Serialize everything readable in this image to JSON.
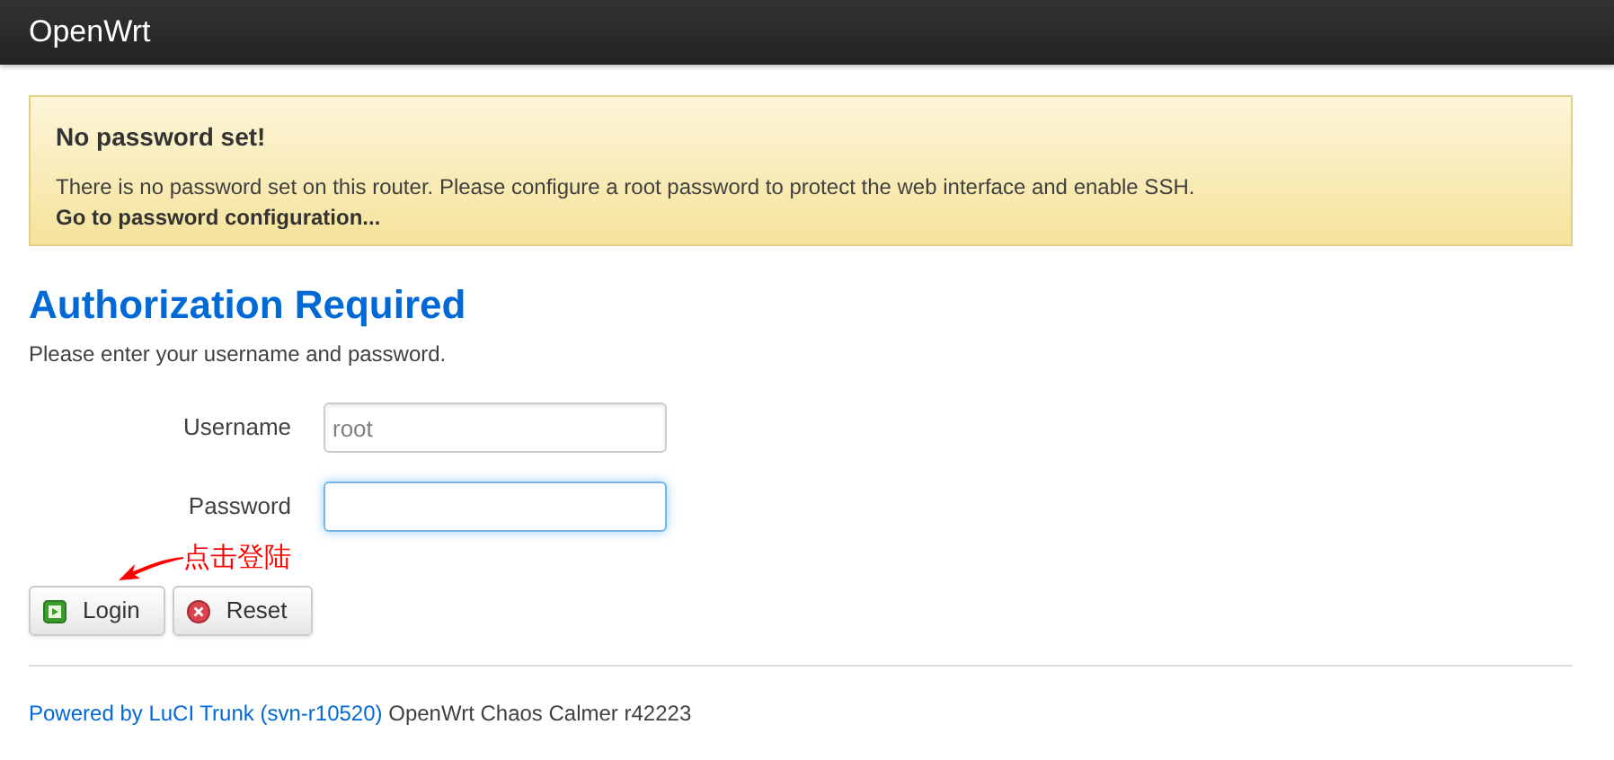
{
  "brand": "OpenWrt",
  "alert": {
    "title": "No password set!",
    "text": "There is no password set on this router. Please configure a root password to protect the web interface and enable SSH.",
    "link": "Go to password configuration..."
  },
  "heading": "Authorization Required",
  "intro": "Please enter your username and password.",
  "fields": [
    {
      "label": "Username",
      "value": "root",
      "focused": false
    },
    {
      "label": "Password",
      "focused": true
    }
  ],
  "buttons": [
    {
      "kind": "login",
      "label": "Login"
    },
    {
      "kind": "reset",
      "label": "Reset"
    }
  ],
  "annotation": {
    "text": "点击登陆"
  },
  "footer": {
    "link": "Powered by LuCI Trunk (svn-r10520)",
    "text": "OpenWrt Chaos Calmer r42223"
  }
}
